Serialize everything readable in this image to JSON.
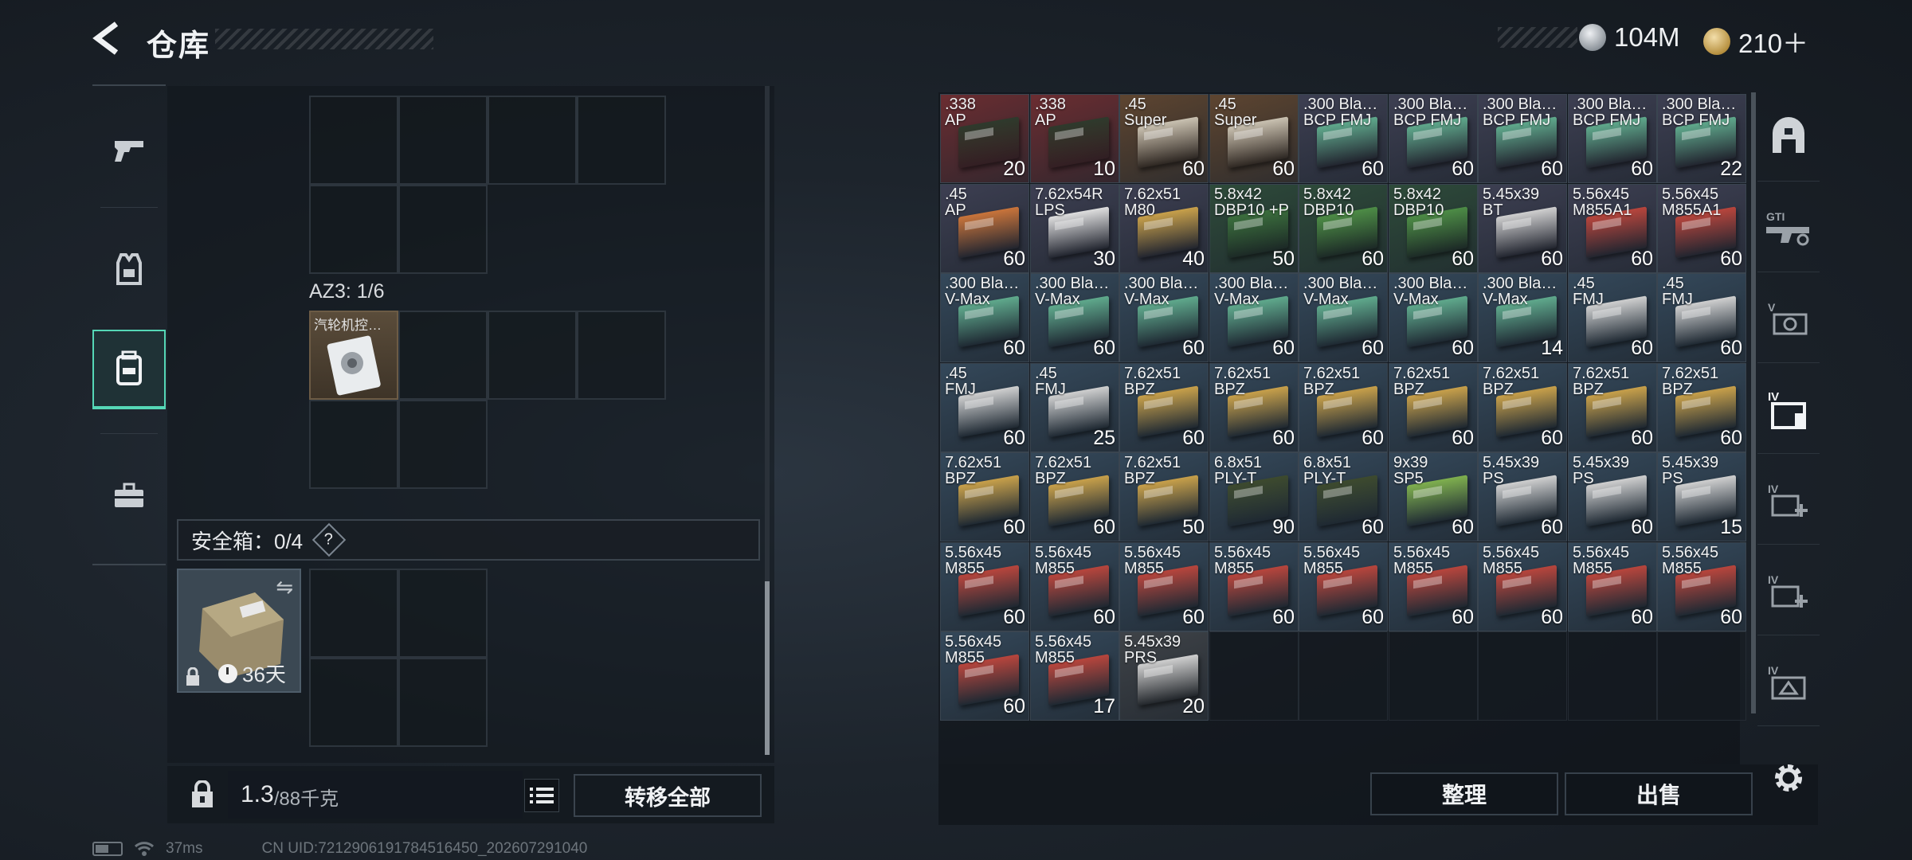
{
  "header": {
    "title": "仓库",
    "currencies": [
      {
        "icon": "silver-coin-icon",
        "value": "104M"
      },
      {
        "icon": "gold-coin-icon",
        "value": "210＋"
      }
    ]
  },
  "left_rail": [
    "weapon-category-icon",
    "gear-category-icon",
    "container-category-icon",
    "toolkit-category-icon"
  ],
  "container": {
    "az_label": "AZ3: 1/6",
    "item": {
      "name": "汽轮机控…",
      "icon": "turbine-part-icon"
    },
    "safebox_label": "安全箱：0/4",
    "help_symbol": "?",
    "safebox_days": "36天",
    "weight_current": "1.3",
    "weight_max": "/88千克",
    "transfer_all_label": "转移全部"
  },
  "stash": {
    "sort_label": "整理",
    "sell_label": "出售",
    "ammo": [
      {
        "name": ".338\nAP",
        "qty": "20",
        "bg": "#6b2d31",
        "box": "#2e3a2c"
      },
      {
        "name": ".338\nAP",
        "qty": "10",
        "bg": "#6b2d31",
        "box": "#2e3a2c"
      },
      {
        "name": ".45\nSuper",
        "qty": "60",
        "bg": "#5e4530",
        "box": "#c9c1b1"
      },
      {
        "name": ".45\nSuper",
        "qty": "60",
        "bg": "#5e4530",
        "box": "#c9c1b1"
      },
      {
        "name": ".300 Bla…\nBCP FMJ",
        "qty": "60",
        "bg": "#3d3f52",
        "box": "#5fa98c"
      },
      {
        "name": ".300 Bla…\nBCP FMJ",
        "qty": "60",
        "bg": "#3d3f52",
        "box": "#5fa98c"
      },
      {
        "name": ".300 Bla…\nBCP FMJ",
        "qty": "60",
        "bg": "#3d3f52",
        "box": "#5fa98c"
      },
      {
        "name": ".300 Bla…\nBCP FMJ",
        "qty": "60",
        "bg": "#3d3f52",
        "box": "#5fa98c"
      },
      {
        "name": ".300 Bla…\nBCP FMJ",
        "qty": "22",
        "bg": "#3d3f52",
        "box": "#5fa98c"
      },
      {
        "name": ".45\nAP",
        "qty": "60",
        "bg": "#3d3f52",
        "box": "#c9743a"
      },
      {
        "name": "7.62x54R\nLPS",
        "qty": "30",
        "bg": "#3d3f52",
        "box": "#dedede"
      },
      {
        "name": "7.62x51\nM80",
        "qty": "40",
        "bg": "#3d3f52",
        "box": "#c8a04a"
      },
      {
        "name": "5.8x42\nDBP10 +P",
        "qty": "50",
        "bg": "#2e4b3a",
        "box": "#3b6e3d"
      },
      {
        "name": "5.8x42\nDBP10",
        "qty": "60",
        "bg": "#2e4b3a",
        "box": "#4d8c46"
      },
      {
        "name": "5.8x42\nDBP10",
        "qty": "60",
        "bg": "#2e4b3a",
        "box": "#4d8c46"
      },
      {
        "name": "5.45x39\nBT",
        "qty": "60",
        "bg": "#3d3f52",
        "box": "#cfcfcf"
      },
      {
        "name": "5.56x45\nM855A1",
        "qty": "60",
        "bg": "#3d3f52",
        "box": "#b8453c"
      },
      {
        "name": "5.56x45\nM855A1",
        "qty": "60",
        "bg": "#3d3f52",
        "box": "#b8453c"
      },
      {
        "name": ".300 Bla…\nV-Max",
        "qty": "60",
        "bg": "#34485a",
        "box": "#5fa98c"
      },
      {
        "name": ".300 Bla…\nV-Max",
        "qty": "60",
        "bg": "#34485a",
        "box": "#5fa98c"
      },
      {
        "name": ".300 Bla…\nV-Max",
        "qty": "60",
        "bg": "#34485a",
        "box": "#5fa98c"
      },
      {
        "name": ".300 Bla…\nV-Max",
        "qty": "60",
        "bg": "#34485a",
        "box": "#5fa98c"
      },
      {
        "name": ".300 Bla…\nV-Max",
        "qty": "60",
        "bg": "#34485a",
        "box": "#5fa98c"
      },
      {
        "name": ".300 Bla…\nV-Max",
        "qty": "60",
        "bg": "#34485a",
        "box": "#5fa98c"
      },
      {
        "name": ".300 Bla…\nV-Max",
        "qty": "14",
        "bg": "#34485a",
        "box": "#5fa98c"
      },
      {
        "name": ".45\nFMJ",
        "qty": "60",
        "bg": "#34485a",
        "box": "#cfcfcf"
      },
      {
        "name": ".45\nFMJ",
        "qty": "60",
        "bg": "#34485a",
        "box": "#cfcfcf"
      },
      {
        "name": ".45\nFMJ",
        "qty": "60",
        "bg": "#34485a",
        "box": "#cfcfcf"
      },
      {
        "name": ".45\nFMJ",
        "qty": "25",
        "bg": "#34485a",
        "box": "#cfcfcf"
      },
      {
        "name": "7.62x51\nBPZ",
        "qty": "60",
        "bg": "#34485a",
        "box": "#c8a04a"
      },
      {
        "name": "7.62x51\nBPZ",
        "qty": "60",
        "bg": "#34485a",
        "box": "#c8a04a"
      },
      {
        "name": "7.62x51\nBPZ",
        "qty": "60",
        "bg": "#34485a",
        "box": "#c8a04a"
      },
      {
        "name": "7.62x51\nBPZ",
        "qty": "60",
        "bg": "#34485a",
        "box": "#c8a04a"
      },
      {
        "name": "7.62x51\nBPZ",
        "qty": "60",
        "bg": "#34485a",
        "box": "#c8a04a"
      },
      {
        "name": "7.62x51\nBPZ",
        "qty": "60",
        "bg": "#34485a",
        "box": "#c8a04a"
      },
      {
        "name": "7.62x51\nBPZ",
        "qty": "60",
        "bg": "#34485a",
        "box": "#c8a04a"
      },
      {
        "name": "7.62x51\nBPZ",
        "qty": "60",
        "bg": "#34485a",
        "box": "#c8a04a"
      },
      {
        "name": "7.62x51\nBPZ",
        "qty": "60",
        "bg": "#34485a",
        "box": "#c8a04a"
      },
      {
        "name": "7.62x51\nBPZ",
        "qty": "50",
        "bg": "#34485a",
        "box": "#c8a04a"
      },
      {
        "name": "6.8x51\nPLY-T",
        "qty": "90",
        "bg": "#34485a",
        "box": "#3d4a2e"
      },
      {
        "name": "6.8x51\nPLY-T",
        "qty": "60",
        "bg": "#34485a",
        "box": "#3d4a2e"
      },
      {
        "name": "9x39\nSP5",
        "qty": "60",
        "bg": "#34485a",
        "box": "#7fb04e"
      },
      {
        "name": "5.45x39\nPS",
        "qty": "60",
        "bg": "#34485a",
        "box": "#cfcfcf"
      },
      {
        "name": "5.45x39\nPS",
        "qty": "60",
        "bg": "#34485a",
        "box": "#cfcfcf"
      },
      {
        "name": "5.45x39\nPS",
        "qty": "15",
        "bg": "#34485a",
        "box": "#cfcfcf"
      },
      {
        "name": "5.56x45\nM855",
        "qty": "60",
        "bg": "#34485a",
        "box": "#b8453c"
      },
      {
        "name": "5.56x45\nM855",
        "qty": "60",
        "bg": "#34485a",
        "box": "#b8453c"
      },
      {
        "name": "5.56x45\nM855",
        "qty": "60",
        "bg": "#34485a",
        "box": "#b8453c"
      },
      {
        "name": "5.56x45\nM855",
        "qty": "60",
        "bg": "#34485a",
        "box": "#b8453c"
      },
      {
        "name": "5.56x45\nM855",
        "qty": "60",
        "bg": "#34485a",
        "box": "#b8453c"
      },
      {
        "name": "5.56x45\nM855",
        "qty": "60",
        "bg": "#34485a",
        "box": "#b8453c"
      },
      {
        "name": "5.56x45\nM855",
        "qty": "60",
        "bg": "#34485a",
        "box": "#b8453c"
      },
      {
        "name": "5.56x45\nM855",
        "qty": "60",
        "bg": "#34485a",
        "box": "#b8453c"
      },
      {
        "name": "5.56x45\nM855",
        "qty": "60",
        "bg": "#34485a",
        "box": "#b8453c"
      },
      {
        "name": "5.56x45\nM855",
        "qty": "60",
        "bg": "#34485a",
        "box": "#b8453c"
      },
      {
        "name": "5.56x45\nM855",
        "qty": "17",
        "bg": "#34485a",
        "box": "#b8453c"
      },
      {
        "name": "5.45x39\nPRS",
        "qty": "20",
        "bg": "#3f4348",
        "box": "#cfcfcf"
      }
    ]
  },
  "right_rail": [
    "fortress-tab-icon",
    "gti-weapons-tab-icon",
    "v-rated-items-tab-icon",
    "iv-container-tab-icon",
    "iv-medical-tab-icon",
    "iv-medical-2-tab-icon",
    "iv-supplies-tab-icon"
  ],
  "status": {
    "ping": "37ms",
    "uid": "CN UID:7212906191784516450_202607291040"
  }
}
